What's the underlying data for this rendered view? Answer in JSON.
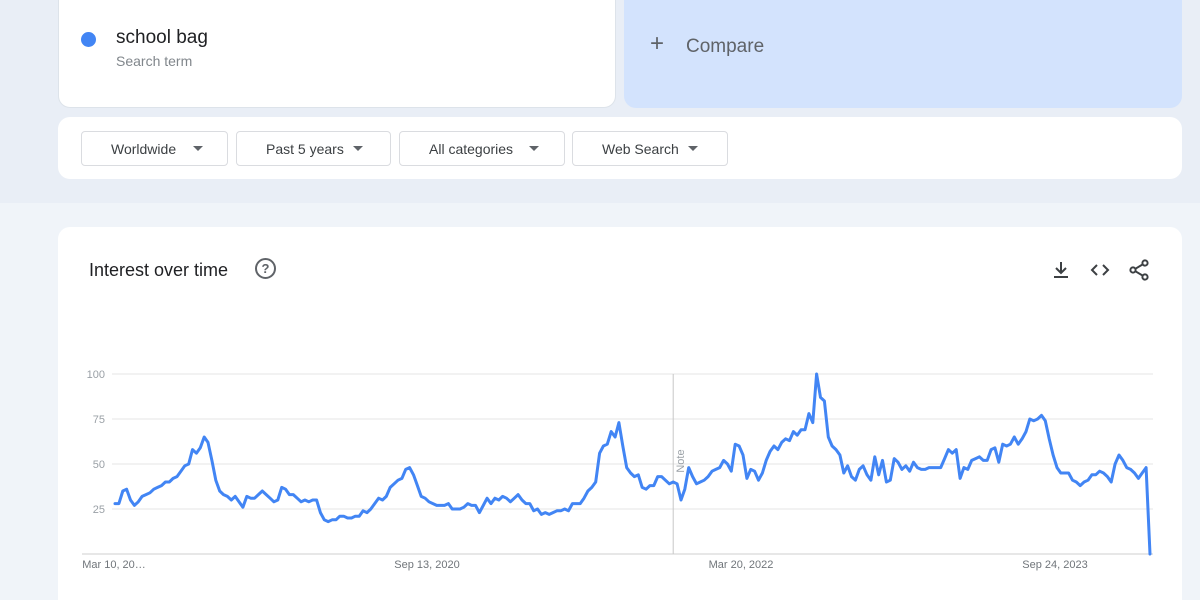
{
  "search_term": {
    "name": "school bag",
    "subtitle": "Search term",
    "color": "#4285f4"
  },
  "compare": {
    "plus": "+",
    "label": "Compare"
  },
  "filters": [
    {
      "label": "Worldwide"
    },
    {
      "label": "Past 5 years"
    },
    {
      "label": "All categories"
    },
    {
      "label": "Web Search"
    }
  ],
  "panel": {
    "title": "Interest over time",
    "help_glyph": "?",
    "icons": [
      "download-icon",
      "embed-code-icon",
      "share-icon"
    ]
  },
  "chart_data": {
    "type": "line",
    "title": "",
    "xlabel": "",
    "ylabel": "",
    "ylim": [
      0,
      100
    ],
    "yticks": [
      25,
      50,
      75,
      100
    ],
    "x_tick_labels": [
      "Mar 10, 20…",
      "Sep 13, 2020",
      "Mar 20, 2022",
      "Sep 24, 2023"
    ],
    "annotation": "Note",
    "grid": true,
    "series": [
      {
        "name": "school bag",
        "color": "#4285f4",
        "values": [
          28,
          28,
          35,
          36,
          30,
          27,
          29,
          32,
          33,
          34,
          36,
          37,
          38,
          40,
          40,
          42,
          43,
          46,
          49,
          50,
          58,
          56,
          59,
          65,
          62,
          52,
          41,
          35,
          33,
          32,
          30,
          32,
          29,
          26,
          32,
          31,
          31,
          33,
          35,
          33,
          31,
          29,
          30,
          37,
          36,
          33,
          33,
          31,
          29,
          30,
          29,
          30,
          30,
          23,
          19,
          18,
          19,
          19,
          21,
          21,
          20,
          20,
          21,
          21,
          24,
          23,
          25,
          28,
          31,
          30,
          32,
          37,
          39,
          41,
          42,
          47,
          48,
          44,
          38,
          32,
          31,
          29,
          28,
          27,
          27,
          27,
          28,
          25,
          25,
          25,
          26,
          28,
          27,
          27,
          23,
          27,
          31,
          28,
          31,
          30,
          32,
          31,
          29,
          31,
          33,
          30,
          28,
          28,
          24,
          25,
          22,
          23,
          22,
          23,
          24,
          24,
          25,
          24,
          28,
          28,
          28,
          31,
          35,
          37,
          40,
          56,
          60,
          61,
          68,
          65,
          73,
          60,
          48,
          45,
          43,
          44,
          37,
          36,
          38,
          38,
          43,
          43,
          41,
          39,
          40,
          39,
          30,
          36,
          48,
          43,
          39,
          40,
          41,
          43,
          46,
          47,
          48,
          52,
          50,
          46,
          61,
          60,
          55,
          42,
          47,
          46,
          41,
          45,
          52,
          57,
          60,
          58,
          62,
          64,
          63,
          68,
          66,
          69,
          69,
          78,
          73,
          100,
          87,
          85,
          65,
          60,
          58,
          55,
          45,
          49,
          43,
          41,
          47,
          49,
          44,
          41,
          54,
          44,
          52,
          40,
          41,
          53,
          51,
          47,
          49,
          46,
          51,
          48,
          47,
          47,
          48,
          48,
          48,
          48,
          53,
          58,
          56,
          58,
          42,
          48,
          47,
          52,
          53,
          54,
          52,
          52,
          58,
          59,
          51,
          61,
          60,
          61,
          65,
          61,
          64,
          68,
          75,
          74,
          75,
          77,
          74,
          64,
          55,
          48,
          45,
          45,
          45,
          41,
          40,
          38,
          40,
          41,
          44,
          44,
          46,
          45,
          43,
          40,
          50,
          55,
          52,
          48,
          47,
          45,
          42,
          45,
          48,
          0
        ]
      }
    ]
  }
}
